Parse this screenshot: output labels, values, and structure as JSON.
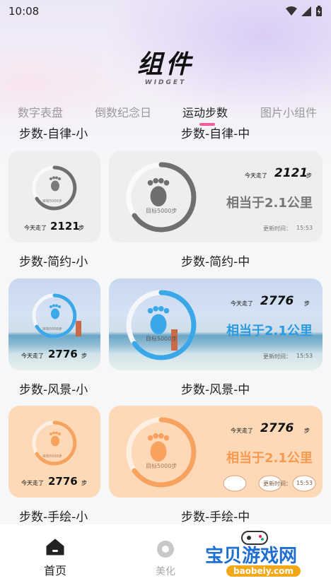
{
  "status": {
    "time": "10:08"
  },
  "header": {
    "title": "组件",
    "subtitle": "WIDGET"
  },
  "tabs": [
    "数字表盘",
    "倒数纪念日",
    "运动步数",
    "图片小组件"
  ],
  "top_labels": {
    "left": "步数-自律-小",
    "right": "步数-自律-中"
  },
  "widgets": {
    "simple": {
      "small_label": "步数-简约-小",
      "medium_label": "步数-简约-中",
      "walked_label": "今天走了",
      "steps_small": "2121",
      "steps_medium": "2121",
      "unit": "步",
      "goal_small": "目标5000步",
      "goal_medium": "目标5000步",
      "equivalent": "相当于2.1公里",
      "update_label": "更新时间：",
      "update_time": "15:53"
    },
    "scenery": {
      "small_label": "步数-风景-小",
      "medium_label": "步数-风景-中",
      "walked_label": "今天走了",
      "steps_small": "2776",
      "steps_medium": "2776",
      "unit": "步",
      "goal_small": "目标5000步",
      "goal_medium": "目标5000步",
      "equivalent": "相当于2.1公里",
      "update_label": "更新时间：",
      "update_time": "15:53"
    },
    "handdrawn": {
      "small_label": "步数-手绘-小",
      "medium_label": "步数-手绘-中",
      "walked_label": "今天走了",
      "steps_small": "2776",
      "steps_medium": "2776",
      "unit": "步",
      "goal_small": "目标5000步",
      "goal_medium": "目标5000步",
      "equivalent": "相当于2.1公里",
      "update_label": "更新时间：",
      "update_time": "15:53"
    }
  },
  "colors": {
    "gray_ring": "#6f6f6f",
    "blue_ring": "#3aa8e8",
    "orange_ring": "#f7a25e",
    "tab_indicator": "#f25c9a"
  },
  "nav": {
    "home": "首页",
    "beautify": "美化"
  },
  "watermark": {
    "title": "宝贝游戏网",
    "url": "baobeiy.com"
  }
}
